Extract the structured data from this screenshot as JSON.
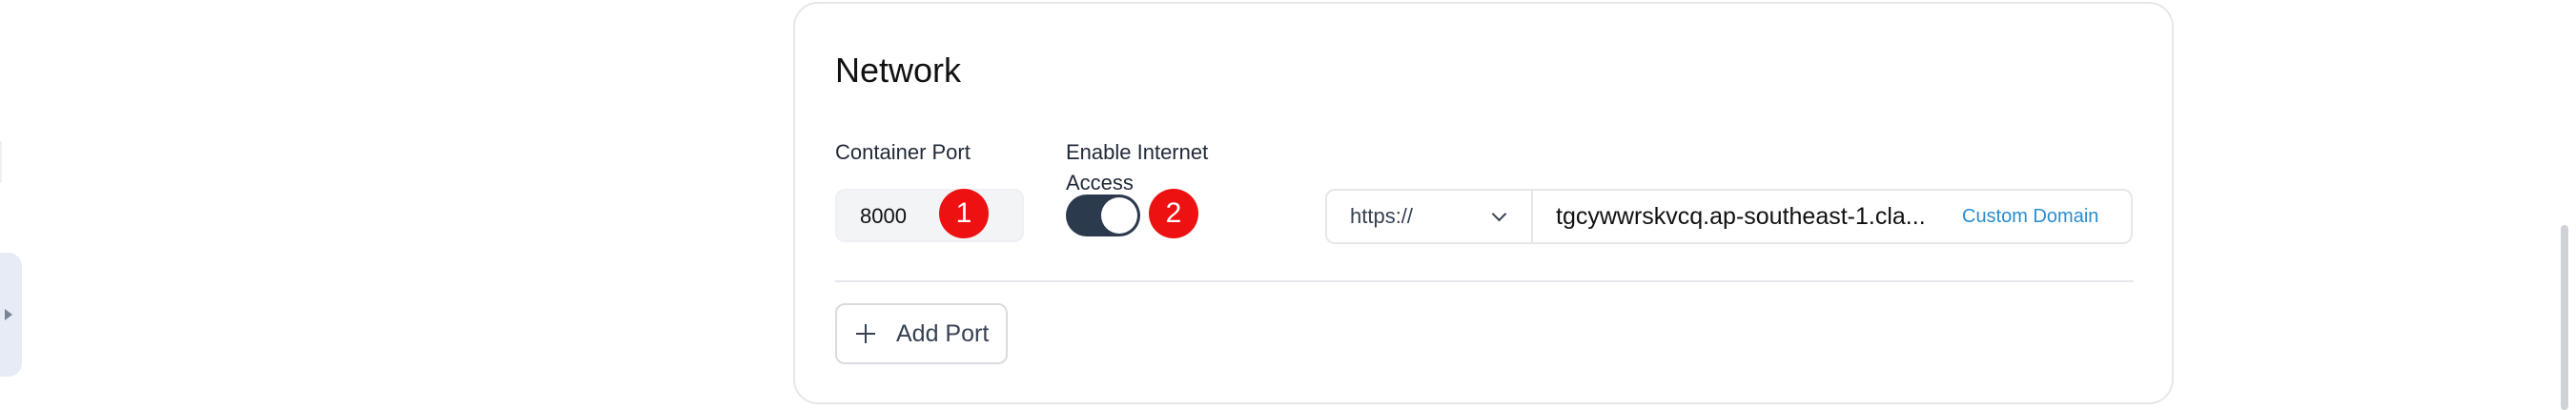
{
  "network": {
    "title": "Network",
    "container_port": {
      "label": "Container Port",
      "value": "8000"
    },
    "internet_access": {
      "label": "Enable Internet Access",
      "enabled": true
    },
    "url": {
      "protocol": "https://",
      "domain": "tgcywwrskvcq.ap-southeast-1.cla...",
      "custom_domain_label": "Custom Domain"
    },
    "add_port_label": "Add Port"
  },
  "annotations": {
    "badge_1": "1",
    "badge_2": "2"
  },
  "colors": {
    "toggle_on": "#2b3a4d",
    "badge": "#ee1111",
    "link": "#2a8ccf"
  }
}
